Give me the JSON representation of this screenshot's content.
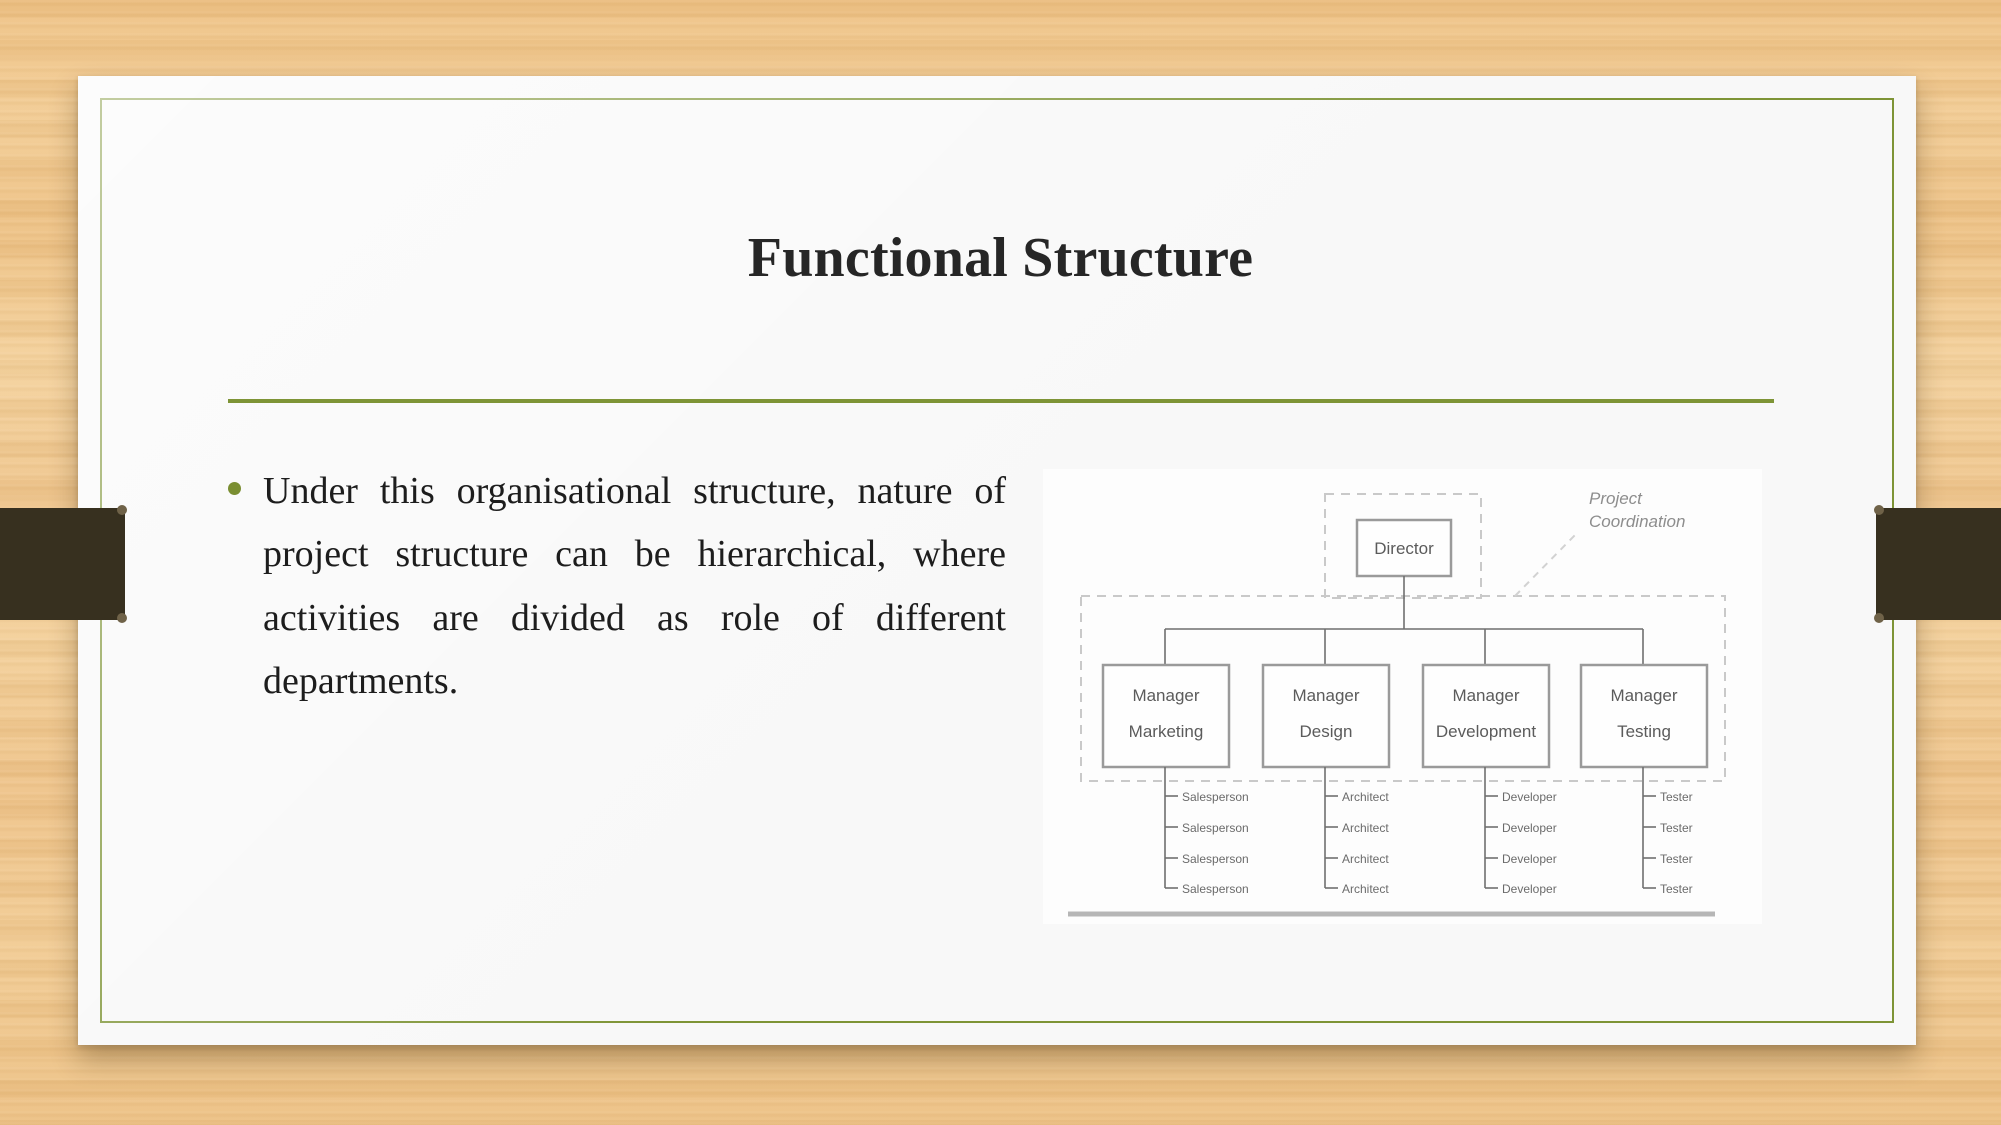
{
  "slide": {
    "title": "Functional Structure",
    "bullet_text": "Under this organisational structure, nature of project structure can be hierarchical, where activities are divided as role of different departments.",
    "accent_color": "#7e9436",
    "bullet_color": "#7a8e31",
    "title_color": "#262626",
    "card_color": "#f8f8f8",
    "ribbon_color": "#37301f",
    "background_color": "#eec184"
  },
  "org_chart": {
    "annotation": {
      "line1": "Project",
      "line2": "Coordination"
    },
    "root": "Director",
    "managers": [
      {
        "line1": "Manager",
        "line2": "Marketing"
      },
      {
        "line1": "Manager",
        "line2": "Design"
      },
      {
        "line1": "Manager",
        "line2": "Development"
      },
      {
        "line1": "Manager",
        "line2": "Testing"
      }
    ],
    "staff_columns": [
      {
        "role": "Salesperson",
        "count": 4,
        "members": [
          "Salesperson",
          "Salesperson",
          "Salesperson",
          "Salesperson"
        ]
      },
      {
        "role": "Architect",
        "count": 4,
        "members": [
          "Architect",
          "Architect",
          "Architect",
          "Architect"
        ]
      },
      {
        "role": "Developer",
        "count": 4,
        "members": [
          "Developer",
          "Developer",
          "Developer",
          "Developer"
        ]
      },
      {
        "role": "Tester",
        "count": 4,
        "members": [
          "Tester",
          "Tester",
          "Tester",
          "Tester"
        ]
      }
    ]
  }
}
